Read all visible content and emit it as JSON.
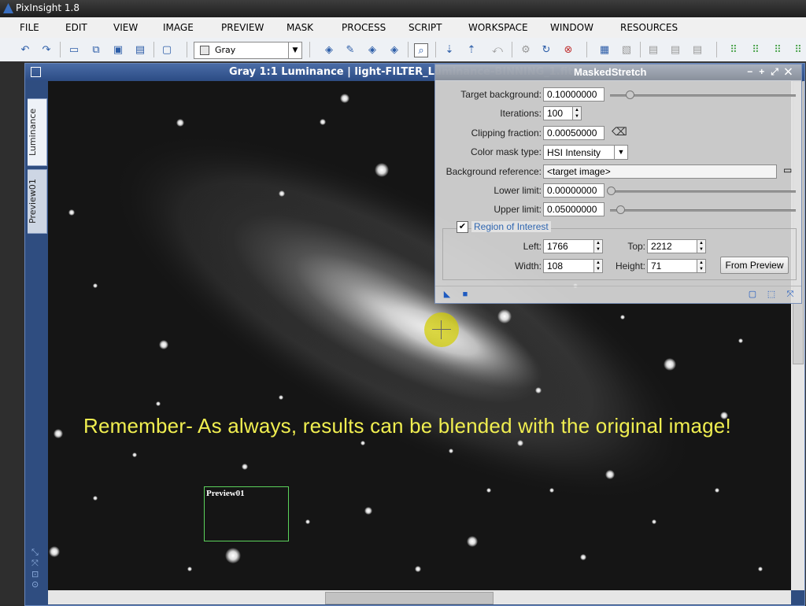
{
  "app": {
    "title": "PixInsight 1.8"
  },
  "menu": [
    "FILE",
    "EDIT",
    "VIEW",
    "IMAGE",
    "PREVIEW",
    "MASK",
    "PROCESS",
    "SCRIPT",
    "WORKSPACE",
    "WINDOW",
    "RESOURCES"
  ],
  "toolbar": {
    "channel_select": "Gray"
  },
  "image_window": {
    "title": "Gray 1:1 Luminance | light-FILTER_Luminance-BINNING_1.fit",
    "tabs": [
      "Luminance",
      "Preview01"
    ],
    "preview_label": "Preview01",
    "caption": "Remember- As always, results can be blended with the original image!"
  },
  "dialog": {
    "title": "MaskedStretch",
    "target_background": {
      "label": "Target background:",
      "value": "0.10000000",
      "slider_fraction": 0.1
    },
    "iterations": {
      "label": "Iterations:",
      "value": "100"
    },
    "clipping_fraction": {
      "label": "Clipping fraction:",
      "value": "0.00050000"
    },
    "color_mask_type": {
      "label": "Color mask type:",
      "value": "HSI Intensity"
    },
    "background_reference": {
      "label": "Background reference:",
      "value": "<target image>"
    },
    "lower_limit": {
      "label": "Lower limit:",
      "value": "0.00000000",
      "slider_fraction": 0.0
    },
    "upper_limit": {
      "label": "Upper limit:",
      "value": "0.05000000",
      "slider_fraction": 0.05
    },
    "roi": {
      "title": "Region of Interest",
      "checked": true,
      "left_label": "Left:",
      "left": "1766",
      "top_label": "Top:",
      "top": "2212",
      "width_label": "Width:",
      "width": "108",
      "height_label": "Height:",
      "height": "71",
      "from_preview": "From Preview"
    }
  },
  "colors": {
    "accent": "#2f4d80",
    "caption": "#f0ee50",
    "preview_border": "#5bd35b",
    "cursor": "#d2cd00"
  }
}
